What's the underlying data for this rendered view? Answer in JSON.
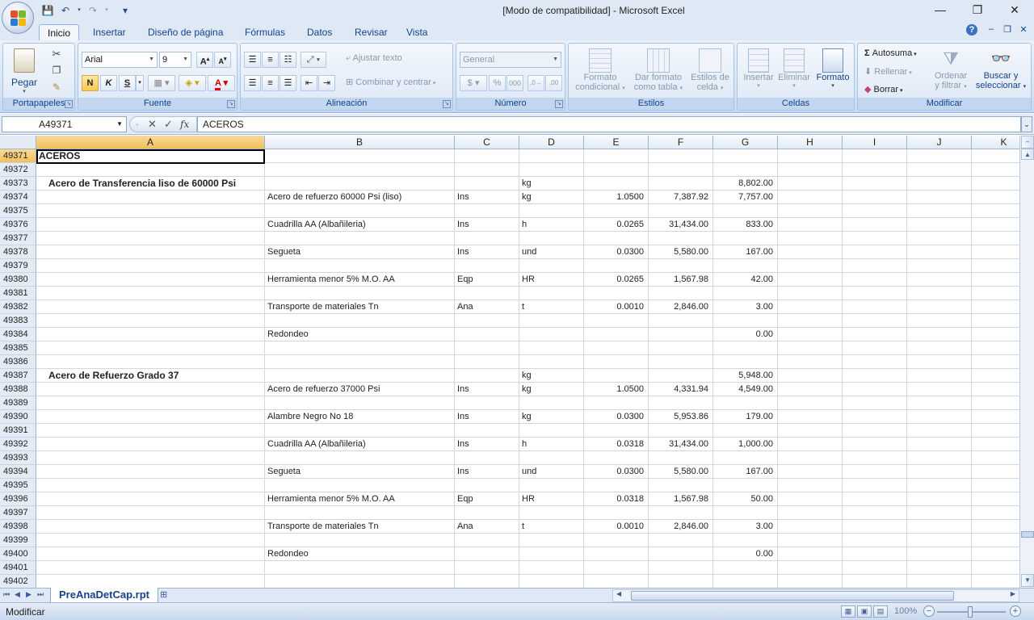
{
  "window": {
    "title": "[Modo de compatibilidad] - Microsoft Excel",
    "minimize": "—",
    "restore": "❐",
    "close": "✕"
  },
  "qat": {
    "save": "💾",
    "undo": "↶",
    "redo": "↷",
    "customize": "▾"
  },
  "tabs": [
    "Inicio",
    "Insertar",
    "Diseño de página",
    "Fórmulas",
    "Datos",
    "Revisar",
    "Vista"
  ],
  "ribbon": {
    "clipboard": {
      "label": "Portapapeles",
      "paste": "Pegar"
    },
    "font": {
      "label": "Fuente",
      "name": "Arial",
      "size": "9",
      "bold": "N",
      "italic": "K",
      "underline": "S"
    },
    "alignment": {
      "label": "Alineación",
      "wrap": "Ajustar texto",
      "merge": "Combinar y centrar"
    },
    "number": {
      "label": "Número",
      "format": "General",
      "currency": "$",
      "percent": "%",
      "thousands": "000"
    },
    "styles": {
      "label": "Estilos",
      "conditional": [
        "Formato",
        "condicional"
      ],
      "table": [
        "Dar formato",
        "como tabla"
      ],
      "cell": [
        "Estilos de",
        "celda"
      ]
    },
    "cells": {
      "label": "Celdas",
      "insert": "Insertar",
      "delete": "Eliminar",
      "format": "Formato"
    },
    "editing": {
      "label": "Modificar",
      "autosum": "Autosuma",
      "fill": "Rellenar",
      "clear": "Borrar",
      "sort": [
        "Ordenar",
        "y filtrar"
      ],
      "find": [
        "Buscar y",
        "seleccionar"
      ]
    }
  },
  "formula_bar": {
    "name_box": "A49371",
    "fx": "fx",
    "content": "ACEROS"
  },
  "columns": [
    "A",
    "B",
    "C",
    "D",
    "E",
    "F",
    "G",
    "H",
    "I",
    "J",
    "K"
  ],
  "rows": [
    {
      "n": "49371",
      "a": "ACEROS",
      "a_bold": true
    },
    {
      "n": "49372"
    },
    {
      "n": "49373",
      "a": "Acero de Transferencia liso  de 60000 Psi",
      "a_bold": true,
      "a_indent": true,
      "d": "kg",
      "g": "8,802.00"
    },
    {
      "n": "49374",
      "b": "Acero de refuerzo 60000 Psi  (liso)",
      "c": "Ins",
      "d": "kg",
      "e": "1.0500",
      "f": "7,387.92",
      "g": "7,757.00"
    },
    {
      "n": "49375"
    },
    {
      "n": "49376",
      "b": "Cuadrilla  AA (Albañileria)",
      "c": "Ins",
      "d": "h",
      "e": "0.0265",
      "f": "31,434.00",
      "g": "833.00"
    },
    {
      "n": "49377"
    },
    {
      "n": "49378",
      "b": "Segueta",
      "c": "Ins",
      "d": "und",
      "e": "0.0300",
      "f": "5,580.00",
      "g": "167.00"
    },
    {
      "n": "49379"
    },
    {
      "n": "49380",
      "b": "Herramienta menor 5% M.O. AA",
      "c": "Eqp",
      "d": "HR",
      "e": "0.0265",
      "f": "1,567.98",
      "g": "42.00"
    },
    {
      "n": "49381"
    },
    {
      "n": "49382",
      "b": "Transporte de materiales Tn",
      "c": "Ana",
      "d": "t",
      "e": "0.0010",
      "f": "2,846.00",
      "g": "3.00"
    },
    {
      "n": "49383"
    },
    {
      "n": "49384",
      "b": "Redondeo",
      "g": "0.00"
    },
    {
      "n": "49385"
    },
    {
      "n": "49386"
    },
    {
      "n": "49387",
      "a": "Acero de Refuerzo Grado 37",
      "a_bold": true,
      "a_indent": true,
      "d": "kg",
      "g": "5,948.00"
    },
    {
      "n": "49388",
      "b": "Acero  de refuerzo 37000 Psi",
      "c": "Ins",
      "d": "kg",
      "e": "1.0500",
      "f": "4,331.94",
      "g": "4,549.00"
    },
    {
      "n": "49389"
    },
    {
      "n": "49390",
      "b": "Alambre Negro  No 18",
      "c": "Ins",
      "d": "kg",
      "e": "0.0300",
      "f": "5,953.86",
      "g": "179.00"
    },
    {
      "n": "49391"
    },
    {
      "n": "49392",
      "b": "Cuadrilla  AA (Albañileria)",
      "c": "Ins",
      "d": "h",
      "e": "0.0318",
      "f": "31,434.00",
      "g": "1,000.00"
    },
    {
      "n": "49393"
    },
    {
      "n": "49394",
      "b": "Segueta",
      "c": "Ins",
      "d": "und",
      "e": "0.0300",
      "f": "5,580.00",
      "g": "167.00"
    },
    {
      "n": "49395"
    },
    {
      "n": "49396",
      "b": "Herramienta menor 5% M.O. AA",
      "c": "Eqp",
      "d": "HR",
      "e": "0.0318",
      "f": "1,567.98",
      "g": "50.00"
    },
    {
      "n": "49397"
    },
    {
      "n": "49398",
      "b": "Transporte de materiales Tn",
      "c": "Ana",
      "d": "t",
      "e": "0.0010",
      "f": "2,846.00",
      "g": "3.00"
    },
    {
      "n": "49399"
    },
    {
      "n": "49400",
      "b": "Redondeo",
      "g": "0.00"
    },
    {
      "n": "49401"
    },
    {
      "n": "49402"
    }
  ],
  "sheet_tab": "PreAnaDetCap.rpt",
  "status": {
    "mode": "Modificar",
    "zoom": "100%"
  }
}
